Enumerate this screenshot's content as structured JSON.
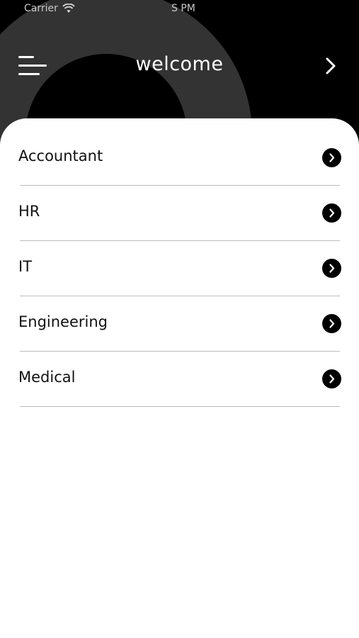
{
  "status_bar": {
    "carrier": "Carrier",
    "time": "S PM"
  },
  "header": {
    "title": "welcome"
  },
  "categories": [
    {
      "label": "Accountant"
    },
    {
      "label": "HR"
    },
    {
      "label": "IT"
    },
    {
      "label": "Engineering"
    },
    {
      "label": "Medical"
    }
  ],
  "colors": {
    "header_background": "#000000",
    "arc_color": "#333333",
    "card_background": "#ffffff",
    "divider": "#bdbdbd"
  },
  "icons": {
    "menu": "hamburger-menu-icon",
    "next": "chevron-right-icon",
    "item_arrow": "circle-chevron-right-icon",
    "wifi": "wifi-icon"
  }
}
